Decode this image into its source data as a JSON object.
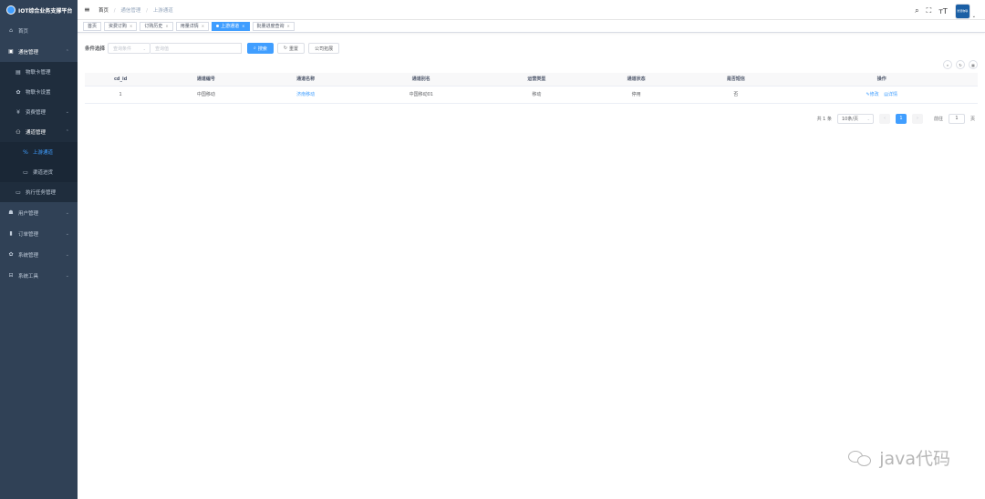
{
  "sidebar": {
    "brand": "IOT综合业务支撑平台",
    "items": [
      {
        "label": "首页",
        "icon": "home-icon",
        "glyph": "⌂"
      },
      {
        "label": "通信管理",
        "icon": "sim-icon",
        "glyph": "▣",
        "arrow": "⌃"
      },
      {
        "label": "物联卡管理",
        "icon": "card-icon",
        "glyph": "▤"
      },
      {
        "label": "物联卡设置",
        "icon": "gear-icon",
        "glyph": "✿"
      },
      {
        "label": "资费管理",
        "icon": "yen-icon",
        "glyph": "¥",
        "arrow": "⌄"
      },
      {
        "label": "通道管理",
        "icon": "tree-icon",
        "glyph": "⚇",
        "arrow": "⌃"
      },
      {
        "label": "上游通道",
        "icon": "link-icon",
        "glyph": "%"
      },
      {
        "label": "渠道进货",
        "icon": "box-icon",
        "glyph": "▭"
      },
      {
        "label": "执行任务管理",
        "icon": "monitor-icon",
        "glyph": "▭"
      },
      {
        "label": "用户管理",
        "icon": "user-icon",
        "glyph": "☗",
        "arrow": "⌄"
      },
      {
        "label": "订单管理",
        "icon": "chart-icon",
        "glyph": "▮",
        "arrow": "⌄"
      },
      {
        "label": "系统管理",
        "icon": "cog-icon",
        "glyph": "✿",
        "arrow": "⌄"
      },
      {
        "label": "系统工具",
        "icon": "tool-icon",
        "glyph": "⊟",
        "arrow": "⌄"
      }
    ]
  },
  "navbar": {
    "hamburger": "≡",
    "crumbs": [
      "首页",
      "通信管理",
      "上游通道"
    ],
    "sep": "/",
    "icons": {
      "search": "⌕",
      "fullscreen": "⛶",
      "font": "ᴛT"
    },
    "avatar_text": "智慧物联",
    "avatar_arrow": "⌄"
  },
  "tags": [
    {
      "label": "首页",
      "closable": false
    },
    {
      "label": "资费订购",
      "closable": true
    },
    {
      "label": "订购历史",
      "closable": true
    },
    {
      "label": "用量详情",
      "closable": true
    },
    {
      "label": "上游通道",
      "closable": true,
      "active": true
    },
    {
      "label": "批量进度查询",
      "closable": true
    }
  ],
  "tag_close": "×",
  "search": {
    "label": "条件选择",
    "select_placeholder": "查询条件",
    "select_arrow": "⌄",
    "input_placeholder": "查询值",
    "search_btn": "搜索",
    "search_glyph": "⌕",
    "reset_btn": "重置",
    "reset_glyph": "↻",
    "company_btn": "公司拓展"
  },
  "toolbar": {
    "search_glyph": "⌕",
    "refresh_glyph": "↻",
    "columns_glyph": "▦"
  },
  "table": {
    "headers": [
      "cd_id",
      "通道编号",
      "通道名称",
      "通道别名",
      "运营类型",
      "通道状态",
      "是否短信",
      "操作"
    ],
    "rows": [
      {
        "cd_id": "1",
        "code": "中国移动",
        "name": "济南移动",
        "alias": "中国移动01",
        "op_type": "移动",
        "status": "停用",
        "sms": "否",
        "edit": "修改",
        "detail": "详情"
      }
    ]
  },
  "pagination": {
    "total": "共 1 条",
    "page_size": "10条/页",
    "size_arrow": "⌄",
    "prev": "‹",
    "next": "›",
    "current": "1",
    "goto_prefix": "前往",
    "goto_value": "1",
    "goto_suffix": "页"
  },
  "watermark": "java代码"
}
